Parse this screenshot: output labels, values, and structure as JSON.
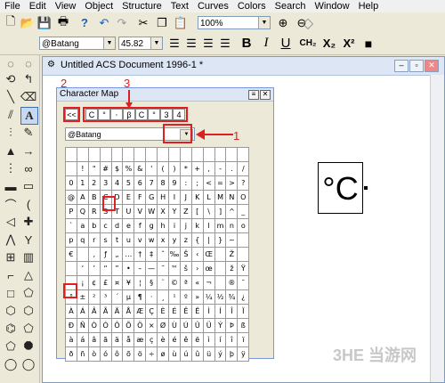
{
  "menu": [
    "File",
    "Edit",
    "View",
    "Object",
    "Structure",
    "Text",
    "Curves",
    "Colors",
    "Search",
    "Window",
    "Help"
  ],
  "toolbar": {
    "zoom_value": "100%",
    "icons": [
      "new-icon",
      "open-icon",
      "save-icon",
      "print-icon",
      "help-icon",
      "undo-icon",
      "redo-icon",
      "cut-icon",
      "copy-icon",
      "paste-icon",
      "zoom-in-icon",
      "zoom-out-icon",
      "stamp-icon"
    ]
  },
  "format_bar": {
    "font": "@Batang",
    "size": "45.82",
    "bold": "B",
    "italic": "I",
    "underline": "U",
    "ch2": "CH₂",
    "x2sub": "X₂",
    "x2sup": "X²"
  },
  "document": {
    "title": "Untitled ACS Document 1996-1 *",
    "sample_text": "°C"
  },
  "charmap": {
    "title": "Character Map",
    "back": "<<",
    "recent": [
      "C",
      "°",
      "⸱",
      "β",
      "C",
      "°",
      "3",
      "4"
    ],
    "font": "@Batang",
    "rows": [
      [
        "",
        "",
        "",
        "",
        "",
        "",
        "",
        "",
        "",
        "",
        "",
        "",
        "",
        "",
        "",
        ""
      ],
      [
        "",
        "!",
        "\"",
        "#",
        "$",
        "%",
        "&",
        "'",
        "(",
        ")",
        "*",
        "+",
        ",",
        "-",
        ".",
        "/"
      ],
      [
        "0",
        "1",
        "2",
        "3",
        "4",
        "5",
        "6",
        "7",
        "8",
        "9",
        ":",
        ";",
        "<",
        "=",
        ">",
        "?"
      ],
      [
        "@",
        "A",
        "B",
        "C",
        "D",
        "E",
        "F",
        "G",
        "H",
        "I",
        "J",
        "K",
        "L",
        "M",
        "N",
        "O"
      ],
      [
        "P",
        "Q",
        "R",
        "S",
        "T",
        "U",
        "V",
        "W",
        "X",
        "Y",
        "Z",
        "[",
        "\\",
        "]",
        "^",
        "_"
      ],
      [
        "`",
        "a",
        "b",
        "c",
        "d",
        "e",
        "f",
        "g",
        "h",
        "i",
        "j",
        "k",
        "l",
        "m",
        "n",
        "o"
      ],
      [
        "p",
        "q",
        "r",
        "s",
        "t",
        "u",
        "v",
        "w",
        "x",
        "y",
        "z",
        "{",
        "|",
        "}",
        "~",
        ""
      ],
      [
        "€",
        "",
        "‚",
        "ƒ",
        "„",
        "…",
        "†",
        "‡",
        "ˆ",
        "‰",
        "Š",
        "‹",
        "Œ",
        "",
        "Ž",
        ""
      ],
      [
        "",
        "‘",
        "’",
        "“",
        "”",
        "•",
        "–",
        "—",
        "˜",
        "™",
        "š",
        "›",
        "œ",
        "",
        "ž",
        "Ÿ"
      ],
      [
        "",
        "¡",
        "¢",
        "£",
        "¤",
        "¥",
        "¦",
        "§",
        "¨",
        "©",
        "ª",
        "«",
        "¬",
        "",
        "®",
        "¯"
      ],
      [
        "°",
        "±",
        "²",
        "³",
        "´",
        "µ",
        "¶",
        "·",
        "¸",
        "¹",
        "º",
        "»",
        "¼",
        "½",
        "¾",
        "¿"
      ],
      [
        "À",
        "Á",
        "Â",
        "Ã",
        "Ä",
        "Å",
        "Æ",
        "Ç",
        "È",
        "É",
        "Ê",
        "Ë",
        "Ì",
        "Í",
        "Î",
        "Ï"
      ],
      [
        "Ð",
        "Ñ",
        "Ò",
        "Ó",
        "Ô",
        "Õ",
        "Ö",
        "×",
        "Ø",
        "Ù",
        "Ú",
        "Û",
        "Ü",
        "Ý",
        "Þ",
        "ß"
      ],
      [
        "à",
        "á",
        "â",
        "ã",
        "ä",
        "å",
        "æ",
        "ç",
        "è",
        "é",
        "ê",
        "ë",
        "ì",
        "í",
        "î",
        "ï"
      ],
      [
        "ð",
        "ñ",
        "ò",
        "ó",
        "ô",
        "õ",
        "ö",
        "÷",
        "ø",
        "ù",
        "ú",
        "û",
        "ü",
        "ý",
        "þ",
        "ÿ"
      ]
    ]
  },
  "annotations": {
    "n1": "1",
    "n2": "2",
    "n3": "3"
  },
  "watermark": "3HE 当游网",
  "colors": {
    "highlight": "#e02020"
  }
}
